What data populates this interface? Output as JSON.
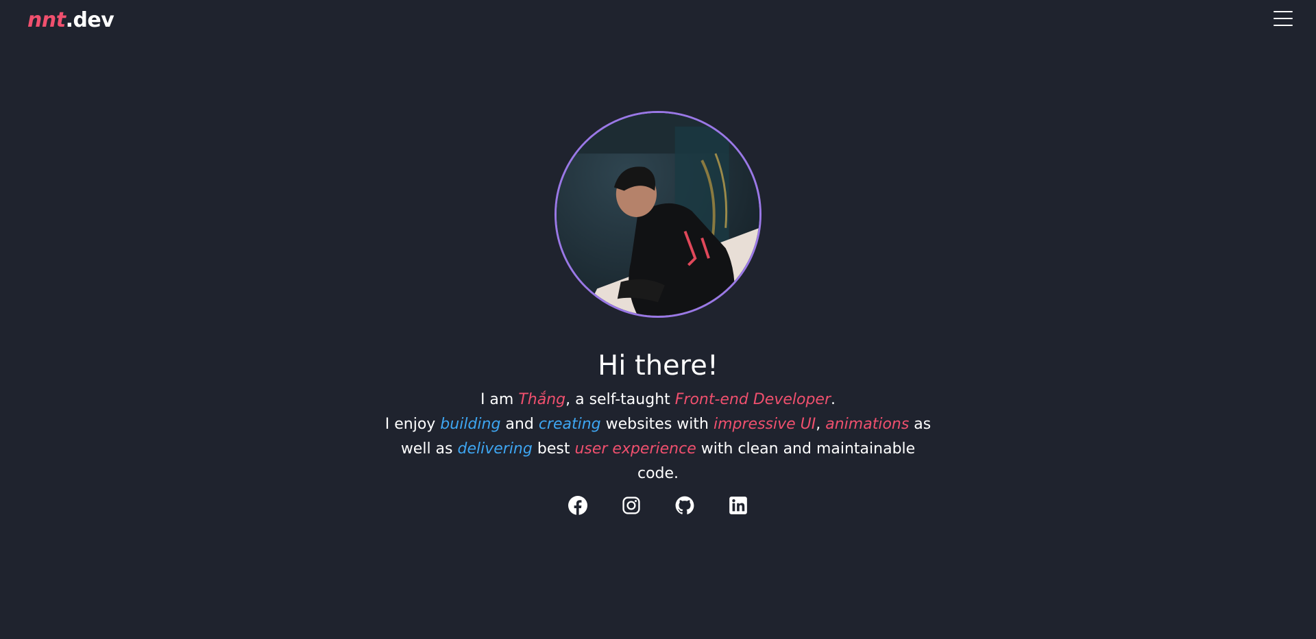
{
  "header": {
    "logo_brand": "nnt",
    "logo_suffix": ".dev",
    "menu_icon": "hamburger-menu-icon"
  },
  "profile": {
    "avatar_icon": "profile-photo",
    "ring_color": "#9a78e6"
  },
  "hero": {
    "title": "Hi there!",
    "line1": {
      "p1": "I am ",
      "name": "Thắng",
      "p2": ", a self-taught ",
      "role": "Front-end Developer",
      "p3": "."
    },
    "line2": {
      "p1": "I enjoy ",
      "w1": "building",
      "p2": " and ",
      "w2": "creating",
      "p3": " websites with ",
      "w3": "impressive UI",
      "p4": ", ",
      "w4": "animations",
      "p5": " as well as ",
      "w5": "delivering",
      "p6": " best ",
      "w6": "user experience",
      "p7": " with clean and maintainable code."
    }
  },
  "social": [
    {
      "name": "facebook",
      "icon": "facebook-icon"
    },
    {
      "name": "instagram",
      "icon": "instagram-icon"
    },
    {
      "name": "github",
      "icon": "github-icon"
    },
    {
      "name": "linkedin",
      "icon": "linkedin-icon"
    }
  ],
  "colors": {
    "background": "#1f232e",
    "accent_red": "#f0506e",
    "accent_blue": "#3ea6f2",
    "text": "#ffffff"
  }
}
